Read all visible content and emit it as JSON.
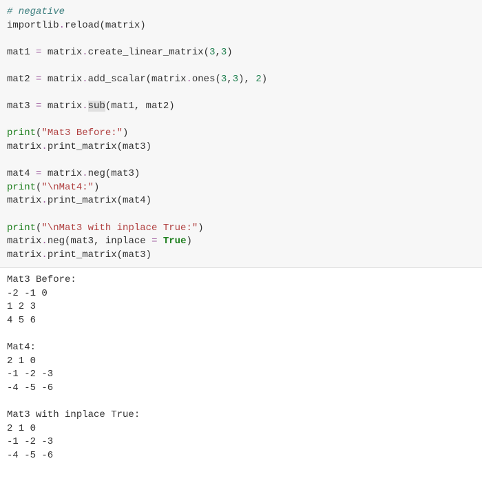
{
  "code": {
    "line1_comment": "# negative",
    "line2_a": "importlib",
    "line2_b": ".",
    "line2_c": "reload(matrix)",
    "blank": "",
    "line4_a": "mat1 ",
    "line4_op": "=",
    "line4_b": " matrix",
    "line4_dot": ".",
    "line4_c": "create_linear_matrix(",
    "line4_n1": "3",
    "line4_comma": ",",
    "line4_n2": "3",
    "line4_d": ")",
    "line6_a": "mat2 ",
    "line6_op": "=",
    "line6_b": " matrix",
    "line6_dot": ".",
    "line6_c": "add_scalar(matrix",
    "line6_dot2": ".",
    "line6_d": "ones(",
    "line6_n1": "3",
    "line6_comma": ",",
    "line6_n2": "3",
    "line6_e": "), ",
    "line6_n3": "2",
    "line6_f": ")",
    "line8_a": "mat3 ",
    "line8_op": "=",
    "line8_b": " matrix",
    "line8_dot": ".",
    "line8_hl": "sub",
    "line8_c": "(mat1, mat2)",
    "line10_fn": "print",
    "line10_a": "(",
    "line10_str": "\"Mat3 Before:\"",
    "line10_b": ")",
    "line11_a": "matrix",
    "line11_dot": ".",
    "line11_b": "print_matrix(mat3)",
    "line13_a": "mat4 ",
    "line13_op": "=",
    "line13_b": " matrix",
    "line13_dot": ".",
    "line13_c": "neg(mat3)",
    "line14_fn": "print",
    "line14_a": "(",
    "line14_str": "\"\\nMat4:\"",
    "line14_b": ")",
    "line15_a": "matrix",
    "line15_dot": ".",
    "line15_b": "print_matrix(mat4)",
    "line17_fn": "print",
    "line17_a": "(",
    "line17_str": "\"\\nMat3 with inplace True:\"",
    "line17_b": ")",
    "line18_a": "matrix",
    "line18_dot": ".",
    "line18_b": "neg(mat3, inplace ",
    "line18_op": "=",
    "line18_sp": " ",
    "line18_kw": "True",
    "line18_c": ")",
    "line19_a": "matrix",
    "line19_dot": ".",
    "line19_b": "print_matrix(mat3)"
  },
  "output": {
    "l1": "Mat3 Before:",
    "l2": "-2 -1 0",
    "l3": "1 2 3",
    "l4": "4 5 6",
    "l5": "",
    "l6": "Mat4:",
    "l7": "2 1 0",
    "l8": "-1 -2 -3",
    "l9": "-4 -5 -6",
    "l10": "",
    "l11": "Mat3 with inplace True:",
    "l12": "2 1 0",
    "l13": "-1 -2 -3",
    "l14": "-4 -5 -6"
  }
}
